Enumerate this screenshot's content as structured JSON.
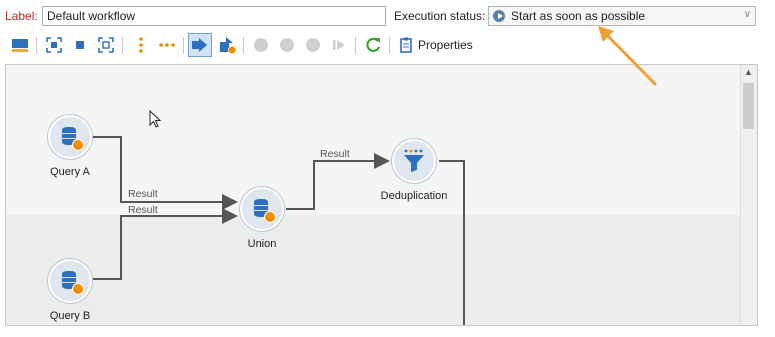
{
  "header": {
    "label_caption": "Label:",
    "label_value": "Default workflow",
    "exec_caption": "Execution status:",
    "exec_value": "Start as soon as possible"
  },
  "toolbar": {
    "properties_label": "Properties",
    "buttons": [
      "layout-icon",
      "fit-icon",
      "stop-square-icon",
      "zoom-fit-icon",
      "vertical-dots-icon",
      "horizontal-dots-icon",
      "start-arrow-icon",
      "pointer-icon",
      "play-icon",
      "pause-icon",
      "stop-icon",
      "step-icon",
      "refresh-icon",
      "properties-icon"
    ]
  },
  "workflow": {
    "nodes": {
      "query_a": "Query A",
      "query_b": "Query B",
      "union": "Union",
      "dedup": "Deduplication"
    },
    "edges": {
      "qa_union": "Result",
      "qb_union": "Result",
      "union_dedup": "Result"
    }
  },
  "colors": {
    "accent": "#2f6fc0",
    "orange": "#f28c00",
    "label_red": "#c62828",
    "arrow": "#f0a030"
  }
}
